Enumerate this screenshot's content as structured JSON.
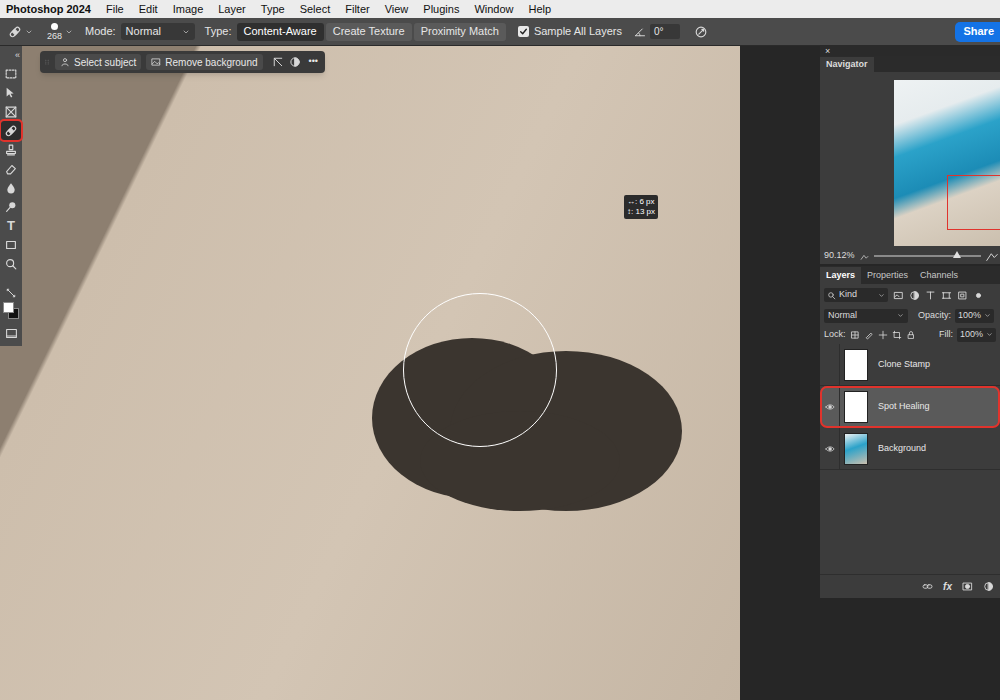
{
  "menu_bar": {
    "app": "Photoshop 2024",
    "items": [
      "File",
      "Edit",
      "Image",
      "Layer",
      "Type",
      "Select",
      "Filter",
      "View",
      "Plugins",
      "Window",
      "Help"
    ]
  },
  "options_bar": {
    "brush_size": "268",
    "mode_label": "Mode:",
    "mode": "Normal",
    "type_label": "Type:",
    "types": [
      {
        "label": "Content-Aware",
        "selected": true
      },
      {
        "label": "Create Texture",
        "selected": false
      },
      {
        "label": "Proximity Match",
        "selected": false
      }
    ],
    "sample_all_layers": {
      "label": "Sample All Layers",
      "checked": true
    },
    "angle": "0°",
    "share": "Share"
  },
  "toolbar": {
    "collapse": "«",
    "tools": [
      {
        "kind": "marquee",
        "selected": false
      },
      {
        "kind": "move",
        "selected": false
      },
      {
        "kind": "frame",
        "selected": false
      },
      {
        "kind": "healing",
        "selected": true
      },
      {
        "kind": "stamp",
        "selected": false
      },
      {
        "kind": "eraser",
        "selected": false
      },
      {
        "kind": "blur",
        "selected": false
      },
      {
        "kind": "dodge",
        "selected": false
      },
      {
        "kind": "type",
        "glyph": "T",
        "selected": false
      },
      {
        "kind": "shape",
        "selected": false
      },
      {
        "kind": "zoom",
        "selected": false
      }
    ],
    "colors": {
      "foreground": "#ffffff",
      "background": "#111111"
    }
  },
  "task_bar": {
    "buttons": [
      {
        "label": "Select subject",
        "kind": "subject"
      },
      {
        "label": "Remove background",
        "kind": "background"
      }
    ],
    "more": "•••"
  },
  "brush_readout": {
    "lines": [
      "↔: 6 px",
      "↕: 13 px"
    ]
  },
  "navigator": {
    "close": "×",
    "title": "Navigator",
    "zoom": "90.12%",
    "zoom_level": 0.78
  },
  "layers_panel": {
    "tabs": [
      {
        "label": "Layers",
        "selected": true
      },
      {
        "label": "Properties",
        "selected": false
      },
      {
        "label": "Channels",
        "selected": false
      }
    ],
    "filter": "Kind",
    "blend_mode": "Normal",
    "opacity_label": "Opacity:",
    "opacity": "100%",
    "lock_label": "Lock:",
    "fill_label": "Fill:",
    "fill": "100%",
    "layers": [
      {
        "name": "Clone Stamp",
        "visible": false,
        "selected": false,
        "kind": "blank"
      },
      {
        "name": "Spot Healing",
        "visible": true,
        "selected": true,
        "kind": "blank"
      },
      {
        "name": "Background",
        "visible": true,
        "selected": false,
        "kind": "photo"
      }
    ],
    "footer_fx": "fx"
  }
}
